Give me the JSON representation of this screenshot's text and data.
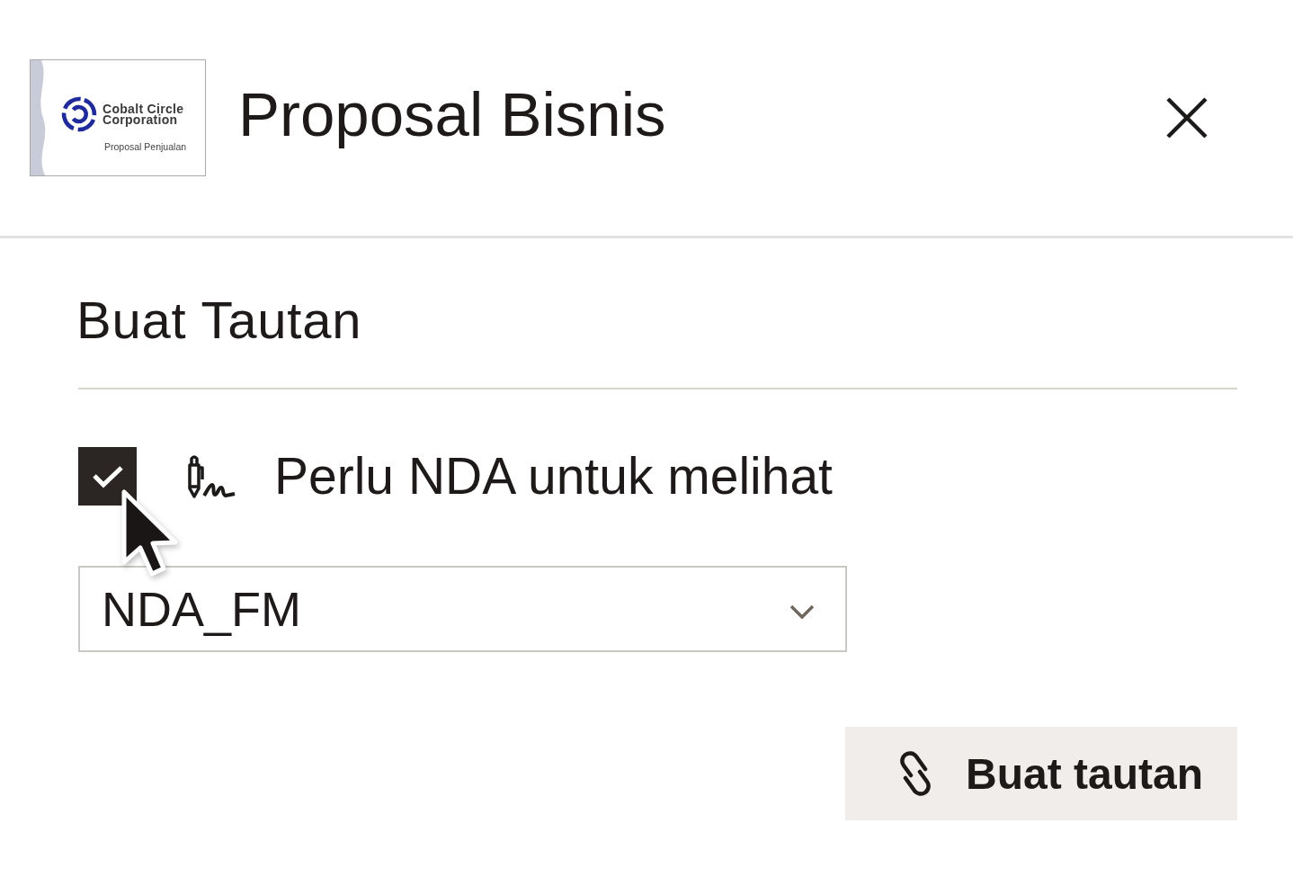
{
  "header": {
    "thumbnail": {
      "company_lines": [
        "Cobalt Circle",
        "Corporation"
      ],
      "subtitle": "Proposal Penjualan"
    },
    "title": "Proposal Bisnis"
  },
  "link_form": {
    "title": "Buat Tautan",
    "nda_option": {
      "label": "Perlu NDA untuk melihat",
      "checked": true
    },
    "nda_select": {
      "value": "NDA_FM"
    },
    "create_button": {
      "label": "Buat tautan"
    }
  }
}
